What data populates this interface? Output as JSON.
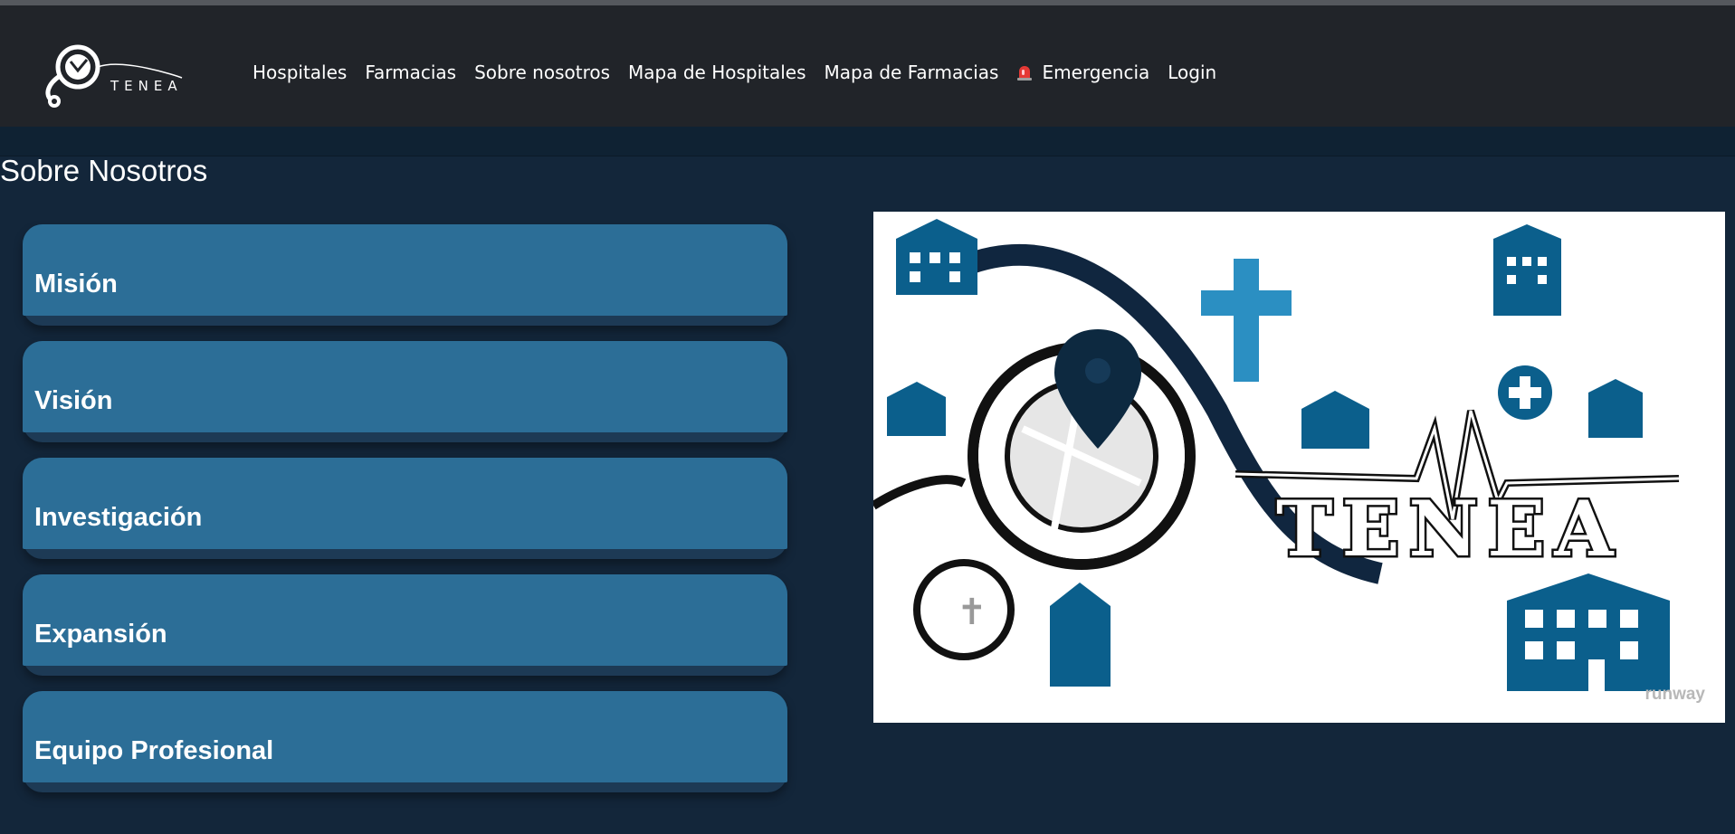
{
  "navbar": {
    "logo_text": "TENEA",
    "links": [
      {
        "label": "Hospitales"
      },
      {
        "label": "Farmacias"
      },
      {
        "label": "Sobre nosotros"
      },
      {
        "label": "Mapa de Hospitales"
      },
      {
        "label": "Mapa de Farmacias"
      },
      {
        "label": "Emergencia",
        "icon": "alarm-siren-icon"
      },
      {
        "label": "Login"
      }
    ]
  },
  "page": {
    "title": "Sobre Nosotros"
  },
  "panels": [
    {
      "label": "Misión"
    },
    {
      "label": "Visión"
    },
    {
      "label": "Investigación"
    },
    {
      "label": "Expansión"
    },
    {
      "label": "Equipo Profesional"
    }
  ],
  "image": {
    "brand_text": "TENEA",
    "watermark": "runway"
  },
  "colors": {
    "navbar_bg": "#212429",
    "page_bg": "#13263a",
    "panel_bg": "#2c6e97",
    "brand_blue": "#0b5f8c"
  }
}
